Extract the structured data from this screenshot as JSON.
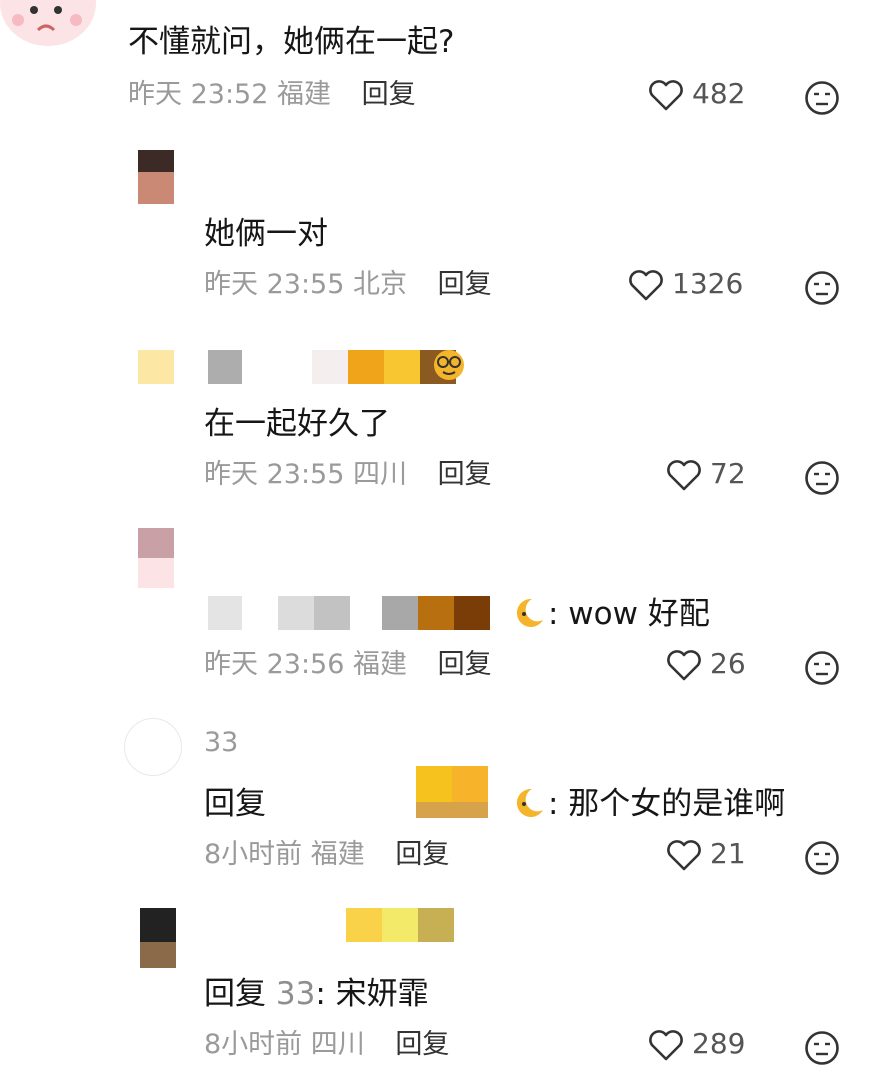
{
  "comments": [
    {
      "text": "不懂就问，她俩在一起?",
      "time": "昨天 23:52",
      "location": "福建",
      "reply_label": "回复",
      "likes": "482"
    },
    {
      "text": "她俩一对",
      "time": "昨天 23:55",
      "location": "北京",
      "reply_label": "回复",
      "likes": "1326"
    },
    {
      "text": "在一起好久了",
      "time": "昨天 23:55",
      "location": "四川",
      "reply_label": "回复",
      "likes": "72"
    },
    {
      "text_suffix": ": wow 好配",
      "time": "昨天 23:56",
      "location": "福建",
      "reply_label": "回复",
      "likes": "26"
    },
    {
      "username": "33",
      "text_prefix": "回复",
      "text_suffix": ": 那个女的是谁啊",
      "time": "8小时前",
      "location": "福建",
      "reply_label": "回复",
      "likes": "21"
    },
    {
      "text_prefix": "回复",
      "reply_to": "33",
      "text_suffix": ": 宋妍霏",
      "time": "8小时前",
      "location": "四川",
      "reply_label": "回复",
      "likes": "289"
    }
  ],
  "colors": {
    "text": "#161616",
    "meta": "#9a9a9a",
    "icon": "#333333"
  },
  "icons": [
    "heart-icon",
    "dislike-face-icon",
    "moon-emoji-icon",
    "glasses-emoji-icon"
  ]
}
